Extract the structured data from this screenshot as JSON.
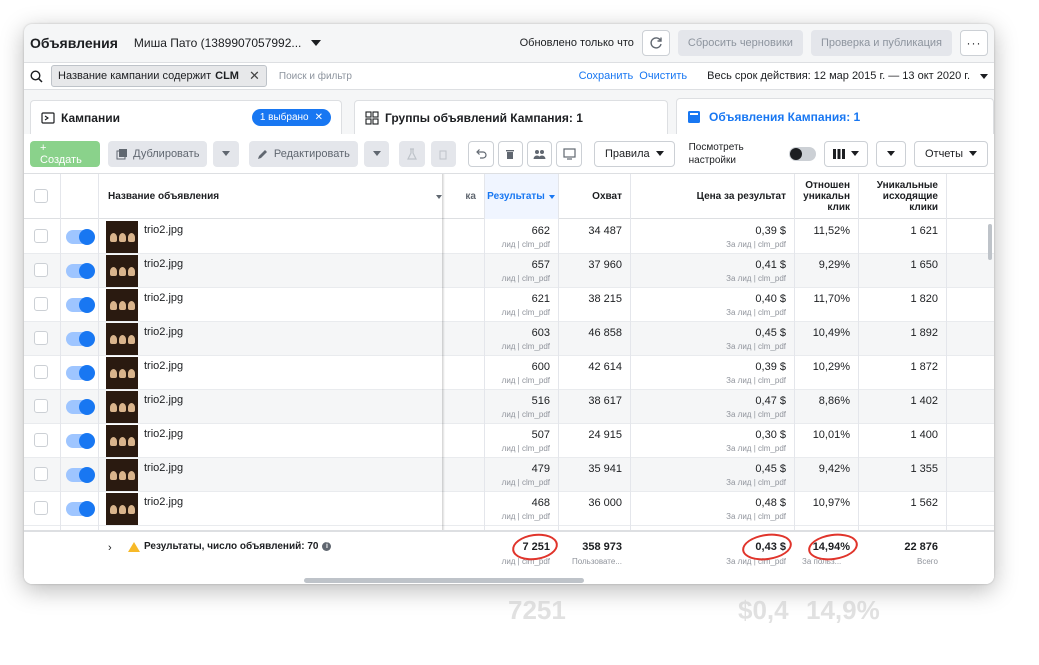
{
  "topbar": {
    "title": "Объявления",
    "account": "Миша Пато (1389907057992...",
    "updated": "Обновлено только что",
    "reset_drafts": "Сбросить черновики",
    "review_publish": "Проверка и публикация",
    "more": "···"
  },
  "filter": {
    "chip_prefix": "Название кампании содержит",
    "chip_value": "CLM",
    "search_placeholder": "Поиск и фильтр",
    "save": "Сохранить",
    "clear": "Очистить",
    "date_range": "Весь срок действия: 12 мар 2015 г. — 13 окт 2020 г."
  },
  "tabs": {
    "campaigns": "Кампании",
    "selected_badge": "1 выбрано",
    "adsets": "Группы объявлений Кампания: 1",
    "ads": "Объявления Кампания: 1"
  },
  "toolbar": {
    "create": "+ Создать",
    "duplicate": "Дублировать",
    "edit": "Редактировать",
    "rules": "Правила",
    "view_settings": "Посмотреть настройки",
    "reports": "Отчеты"
  },
  "columns": {
    "ad_name": "Название объявления",
    "hidden_tail": "ка",
    "results": "Результаты",
    "reach": "Охват",
    "cost_per_result": "Цена за результат",
    "ratio_line1": "Отношен",
    "ratio_line2": "уникальн",
    "ratio_line3": "клик",
    "unique_line1": "Уникальные",
    "unique_line2": "исходящие",
    "unique_line3": "клики"
  },
  "rows": [
    {
      "name": "trio2.jpg",
      "results": "662",
      "results_sub": "лид | clm_pdf",
      "reach": "34 487",
      "cost": "0,39 $",
      "cost_sub": "За лид | clm_pdf",
      "ratio": "11,52%",
      "unique": "1 621"
    },
    {
      "name": "trio2.jpg",
      "results": "657",
      "results_sub": "лид | clm_pdf",
      "reach": "37 960",
      "cost": "0,41 $",
      "cost_sub": "За лид | clm_pdf",
      "ratio": "9,29%",
      "unique": "1 650"
    },
    {
      "name": "trio2.jpg",
      "results": "621",
      "results_sub": "лид | clm_pdf",
      "reach": "38 215",
      "cost": "0,40 $",
      "cost_sub": "За лид | clm_pdf",
      "ratio": "11,70%",
      "unique": "1 820"
    },
    {
      "name": "trio2.jpg",
      "results": "603",
      "results_sub": "лид | clm_pdf",
      "reach": "46 858",
      "cost": "0,45 $",
      "cost_sub": "За лид | clm_pdf",
      "ratio": "10,49%",
      "unique": "1 892"
    },
    {
      "name": "trio2.jpg",
      "results": "600",
      "results_sub": "лид | clm_pdf",
      "reach": "42 614",
      "cost": "0,39 $",
      "cost_sub": "За лид | clm_pdf",
      "ratio": "10,29%",
      "unique": "1 872"
    },
    {
      "name": "trio2.jpg",
      "results": "516",
      "results_sub": "лид | clm_pdf",
      "reach": "38 617",
      "cost": "0,47 $",
      "cost_sub": "За лид | clm_pdf",
      "ratio": "8,86%",
      "unique": "1 402"
    },
    {
      "name": "trio2.jpg",
      "results": "507",
      "results_sub": "лид | clm_pdf",
      "reach": "24 915",
      "cost": "0,30 $",
      "cost_sub": "За лид | clm_pdf",
      "ratio": "10,01%",
      "unique": "1 400"
    },
    {
      "name": "trio2.jpg",
      "results": "479",
      "results_sub": "лид | clm_pdf",
      "reach": "35 941",
      "cost": "0,45 $",
      "cost_sub": "За лид | clm_pdf",
      "ratio": "9,42%",
      "unique": "1 355"
    },
    {
      "name": "trio2.jpg",
      "results": "468",
      "results_sub": "лид | clm_pdf",
      "reach": "36 000",
      "cost": "0,48 $",
      "cost_sub": "За лид | clm_pdf",
      "ratio": "10,97%",
      "unique": "1 562"
    }
  ],
  "totals": {
    "label": "Результаты, число объявлений: 70",
    "results": "7 251",
    "results_sub": "лид | clm_pdf",
    "reach": "358 973",
    "reach_sub": "Пользовате...",
    "cost": "0,43 $",
    "cost_sub": "За лид | clm_pdf",
    "ratio": "14,94%",
    "ratio_sub": "За польз...",
    "unique": "22 876",
    "unique_sub": "Всего"
  },
  "annotations": {
    "ghost_results": "7251",
    "ghost_cost": "$0,4",
    "ghost_ratio": "14,9%",
    "circle_color": "#e0342b"
  },
  "colors": {
    "accent": "#1877f2",
    "create_green": "#8ad28b",
    "warning": "#f7b928"
  }
}
